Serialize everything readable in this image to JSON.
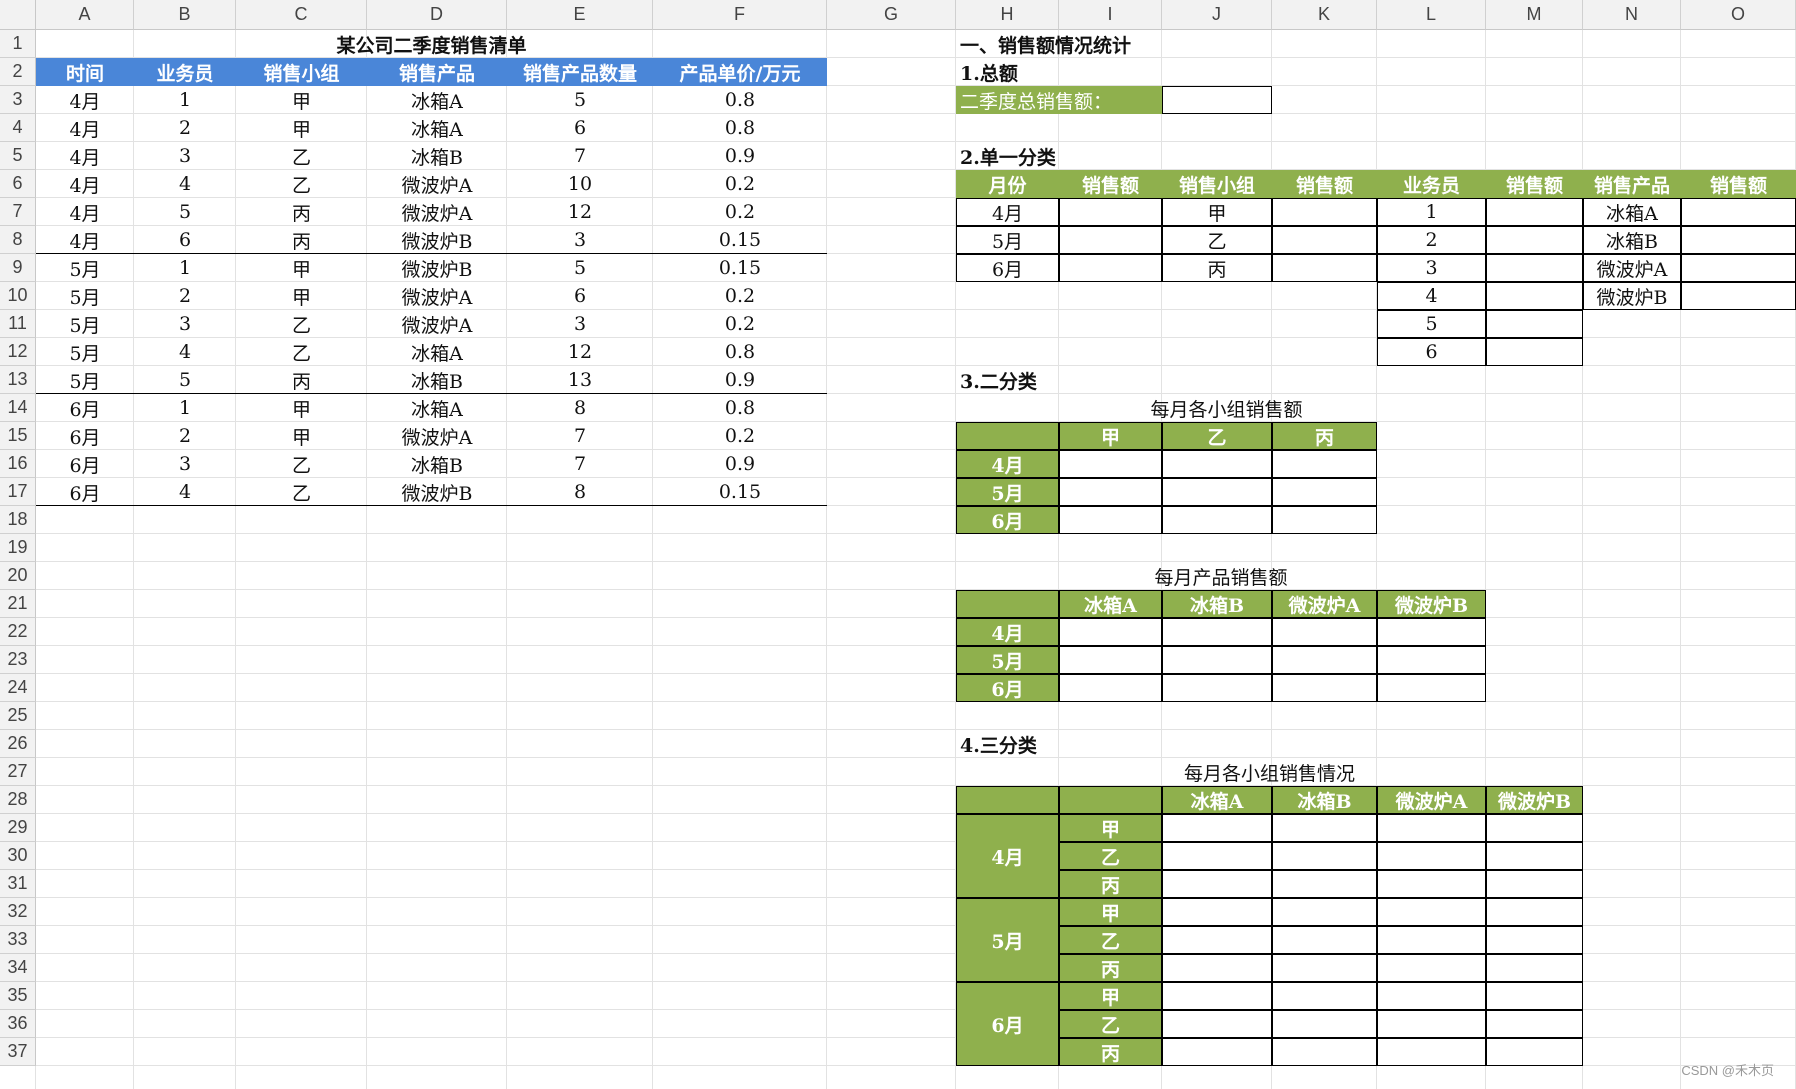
{
  "columns": [
    "A",
    "B",
    "C",
    "D",
    "E",
    "F",
    "G",
    "H",
    "I",
    "J",
    "K",
    "L",
    "M",
    "N",
    "O"
  ],
  "rows": [
    "1",
    "2",
    "3",
    "4",
    "5",
    "6",
    "7",
    "8",
    "9",
    "10",
    "11",
    "12",
    "13",
    "14",
    "15",
    "16",
    "17",
    "18",
    "19",
    "20",
    "21",
    "22",
    "23",
    "24",
    "25",
    "26",
    "27",
    "28",
    "29",
    "30",
    "31",
    "32",
    "33",
    "34",
    "35",
    "36",
    "37"
  ],
  "sales": {
    "title": "某公司二季度销售清单",
    "headers": [
      "时间",
      "业务员",
      "销售小组",
      "销售产品",
      "销售产品数量",
      "产品单价/万元"
    ],
    "records": [
      [
        "4月",
        "1",
        "甲",
        "冰箱A",
        "5",
        "0.8"
      ],
      [
        "4月",
        "2",
        "甲",
        "冰箱A",
        "6",
        "0.8"
      ],
      [
        "4月",
        "3",
        "乙",
        "冰箱B",
        "7",
        "0.9"
      ],
      [
        "4月",
        "4",
        "乙",
        "微波炉A",
        "10",
        "0.2"
      ],
      [
        "4月",
        "5",
        "丙",
        "微波炉A",
        "12",
        "0.2"
      ],
      [
        "4月",
        "6",
        "丙",
        "微波炉B",
        "3",
        "0.15"
      ],
      [
        "5月",
        "1",
        "甲",
        "微波炉B",
        "5",
        "0.15"
      ],
      [
        "5月",
        "2",
        "甲",
        "微波炉A",
        "6",
        "0.2"
      ],
      [
        "5月",
        "3",
        "乙",
        "微波炉A",
        "3",
        "0.2"
      ],
      [
        "5月",
        "4",
        "乙",
        "冰箱A",
        "12",
        "0.8"
      ],
      [
        "5月",
        "5",
        "丙",
        "冰箱B",
        "13",
        "0.9"
      ],
      [
        "6月",
        "1",
        "甲",
        "冰箱A",
        "8",
        "0.8"
      ],
      [
        "6月",
        "2",
        "甲",
        "微波炉A",
        "7",
        "0.2"
      ],
      [
        "6月",
        "3",
        "乙",
        "冰箱B",
        "7",
        "0.9"
      ],
      [
        "6月",
        "4",
        "乙",
        "微波炉B",
        "8",
        "0.15"
      ]
    ]
  },
  "stats": {
    "heading": "一、销售额情况统计",
    "total": {
      "heading": "1.总额",
      "label": "二季度总销售额："
    },
    "single": {
      "heading": "2.单一分类",
      "headers": [
        "月份",
        "销售额",
        "销售小组",
        "销售额",
        "业务员",
        "销售额",
        "销售产品",
        "销售额"
      ],
      "months": [
        "4月",
        "5月",
        "6月"
      ],
      "groups": [
        "甲",
        "乙",
        "丙"
      ],
      "staff": [
        "1",
        "2",
        "3",
        "4",
        "5",
        "6"
      ],
      "products": [
        "冰箱A",
        "冰箱B",
        "微波炉A",
        "微波炉B"
      ]
    },
    "two": {
      "heading": "3.二分类",
      "t1": {
        "title": "每月各小组销售额",
        "cols": [
          "甲",
          "乙",
          "丙"
        ],
        "rows": [
          "4月",
          "5月",
          "6月"
        ]
      },
      "t2": {
        "title": "每月产品销售额",
        "cols": [
          "冰箱A",
          "冰箱B",
          "微波炉A",
          "微波炉B"
        ],
        "rows": [
          "4月",
          "5月",
          "6月"
        ]
      }
    },
    "three": {
      "heading": "4.三分类",
      "title": "每月各小组销售情况",
      "cols": [
        "冰箱A",
        "冰箱B",
        "微波炉A",
        "微波炉B"
      ],
      "months": [
        "4月",
        "5月",
        "6月"
      ],
      "groups": [
        "甲",
        "乙",
        "丙"
      ]
    }
  },
  "watermark": "CSDN @禾木页"
}
